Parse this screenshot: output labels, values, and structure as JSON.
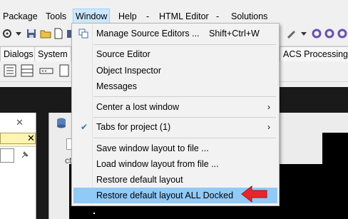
{
  "menubar": {
    "items": [
      "Package",
      "Tools",
      "Window",
      "Help",
      "-",
      "HTML Editor",
      "-",
      "Solutions"
    ],
    "active": "Window"
  },
  "tabs": {
    "left": [
      "Dialogs",
      "System"
    ],
    "right": "ACS Processing"
  },
  "editor": {
    "partial_text": "ct"
  },
  "window_menu": {
    "items": [
      {
        "label": "Manage Source Editors ...",
        "shortcut": "Shift+Ctrl+W"
      },
      {
        "label": "Source Editor"
      },
      {
        "label": "Object Inspector"
      },
      {
        "label": "Messages"
      },
      {
        "label": "Center a lost window"
      },
      {
        "label": "Tabs for project (1)"
      },
      {
        "label": "Save window layout to file ..."
      },
      {
        "label": "Load window layout from file ..."
      },
      {
        "label": "Restore default layout"
      },
      {
        "label": "Restore default layout ALL Docked"
      }
    ],
    "checked_item": "Tabs for project (1)",
    "highlighted_item": "Restore default layout ALL Docked"
  },
  "colors": {
    "highlight": "#91c9f7",
    "arrow": "#e8262a",
    "workspace": "#1a1a1a"
  }
}
